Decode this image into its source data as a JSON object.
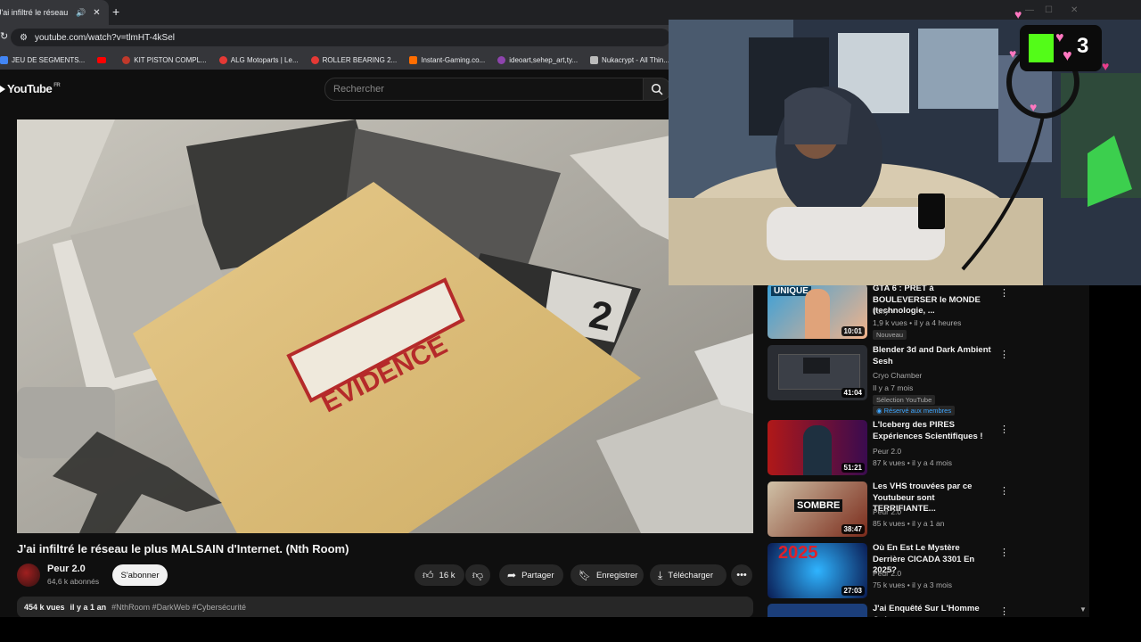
{
  "browser": {
    "tab_title": "J'ai infiltré le réseau le plus MALSAIN",
    "url": "youtube.com/watch?v=tlmHT-4kSel",
    "bookmarks": [
      {
        "label": "JEU DE SEGMENTS...",
        "color": "#4285f4"
      },
      {
        "label": "",
        "color": "#ff0000"
      },
      {
        "label": "KIT PISTON COMPL...",
        "color": "#c0392b"
      },
      {
        "label": "ALG Motoparts | Le...",
        "color": "#e53935"
      },
      {
        "label": "ROLLER BEARING 2...",
        "color": "#e53935"
      },
      {
        "label": "Instant-Gaming.co...",
        "color": "#ff6d00"
      },
      {
        "label": "ideoart,sehep_art,ty...",
        "color": "#8e44ad"
      },
      {
        "label": "Nukacrypt - All Thin...",
        "color": "#bbbbbb"
      }
    ]
  },
  "youtube": {
    "logo_text": "YouTube",
    "logo_region": "FR",
    "search_placeholder": "Rechercher"
  },
  "video": {
    "title": "J'ai infiltré le réseau le plus MALSAIN d'Internet. (Nth Room)",
    "evidence_label": "EVIDENCE",
    "tag_number": "2",
    "channel": "Peur 2.0",
    "subscribers": "64,6 k abonnés",
    "subscribe_label": "S'abonner",
    "likes": "16 k",
    "share_label": "Partager",
    "save_label": "Enregistrer",
    "download_label": "Télécharger",
    "views": "454 k vues",
    "age": "il y a 1 an",
    "hashtags": "#NthRoom #DarkWeb #Cybersécurité"
  },
  "recommendations": [
    {
      "title": "GTA 6 : PRÊT à BOULEVERSER le MONDE (technologie, ...",
      "channel": "Tony +",
      "meta": "1,9 k vues • il y a 4 heures",
      "badge": "Nouveau",
      "duration": "10:01",
      "thumb_text": "UNIQUE",
      "thumb_color": "#3aa0d8"
    },
    {
      "title": "Blender 3d and Dark Ambient Sesh",
      "channel": "Cryo Chamber",
      "meta": "Il y a 7 mois",
      "badge": "Sélection YouTube",
      "badge2": "Réservé aux membres",
      "duration": "41:04",
      "thumb_text": "",
      "thumb_color": "#2a2d33"
    },
    {
      "title": "L'Iceberg des PIRES Expériences Scientifiques !",
      "channel": "Peur 2.0",
      "meta": "87 k vues • il y a 4 mois",
      "duration": "51:21",
      "thumb_text": "",
      "thumb_color": "#b01818"
    },
    {
      "title": "Les VHS trouvées par ce Youtubeur sont TERRIFIANTE...",
      "channel": "Peur 2.0",
      "meta": "85 k vues • il y a 1 an",
      "duration": "38:47",
      "thumb_text": "SOMBRE",
      "thumb_color": "#7a2a1a"
    },
    {
      "title": "Où En Est Le Mystère Derrière CICADA 3301 En 2025?",
      "channel": "Peur 2.0",
      "meta": "75 k vues • il y a 3 mois",
      "duration": "27:03",
      "thumb_text": "2025",
      "thumb_color": "#123a8a"
    },
    {
      "title": "J'ai Enquêté Sur L'Homme Qui",
      "channel": "",
      "meta": "",
      "duration": "",
      "thumb_text": "",
      "thumb_color": "#1b3e7a"
    }
  ],
  "overlay": {
    "counter": "3"
  }
}
